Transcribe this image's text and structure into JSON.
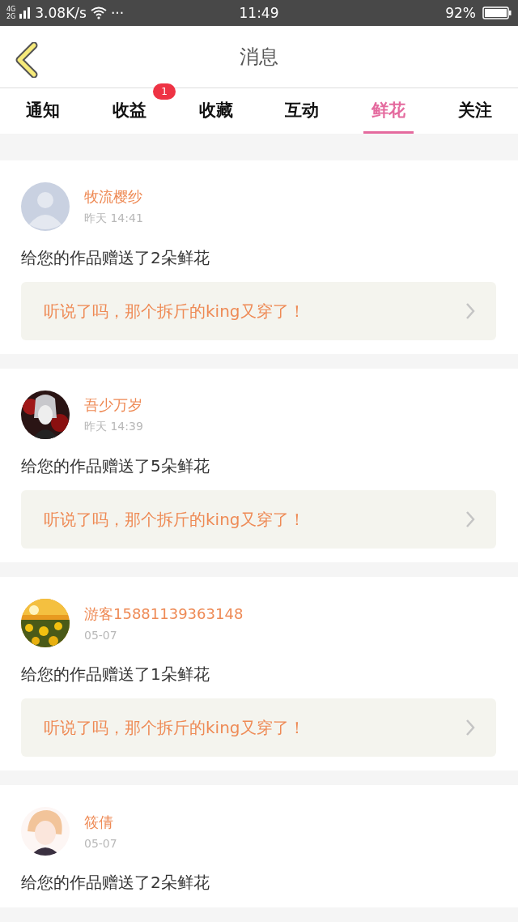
{
  "status_bar": {
    "network_top": "4G",
    "network_bottom": "2G",
    "speed": "3.08K/s",
    "more": "···",
    "time": "11:49",
    "battery": "92%"
  },
  "header": {
    "title": "消息"
  },
  "tabs": [
    {
      "label": "通知",
      "selected": false
    },
    {
      "label": "收益",
      "selected": false,
      "badge": "1"
    },
    {
      "label": "收藏",
      "selected": false
    },
    {
      "label": "互动",
      "selected": false
    },
    {
      "label": "鲜花",
      "selected": true
    },
    {
      "label": "关注",
      "selected": false
    }
  ],
  "messages": [
    {
      "avatar": {
        "kind": "silhouette"
      },
      "name": "牧流樱纱",
      "time": "昨天 14:41",
      "text": "给您的作品赠送了2朵鲜花",
      "quote": "听说了吗，那个拆斤的king又穿了！"
    },
    {
      "avatar": {
        "kind": "dark"
      },
      "name": "吾少万岁",
      "time": "昨天 14:39",
      "text": "给您的作品赠送了5朵鲜花",
      "quote": "听说了吗，那个拆斤的king又穿了！"
    },
    {
      "avatar": {
        "kind": "sunflowers"
      },
      "name": "游客15881139363148",
      "time": "05-07",
      "text": "给您的作品赠送了1朵鲜花",
      "quote": "听说了吗，那个拆斤的king又穿了！"
    },
    {
      "avatar": {
        "kind": "pastel"
      },
      "name": "筱倩",
      "time": "05-07",
      "text": "给您的作品赠送了2朵鲜花"
    }
  ]
}
